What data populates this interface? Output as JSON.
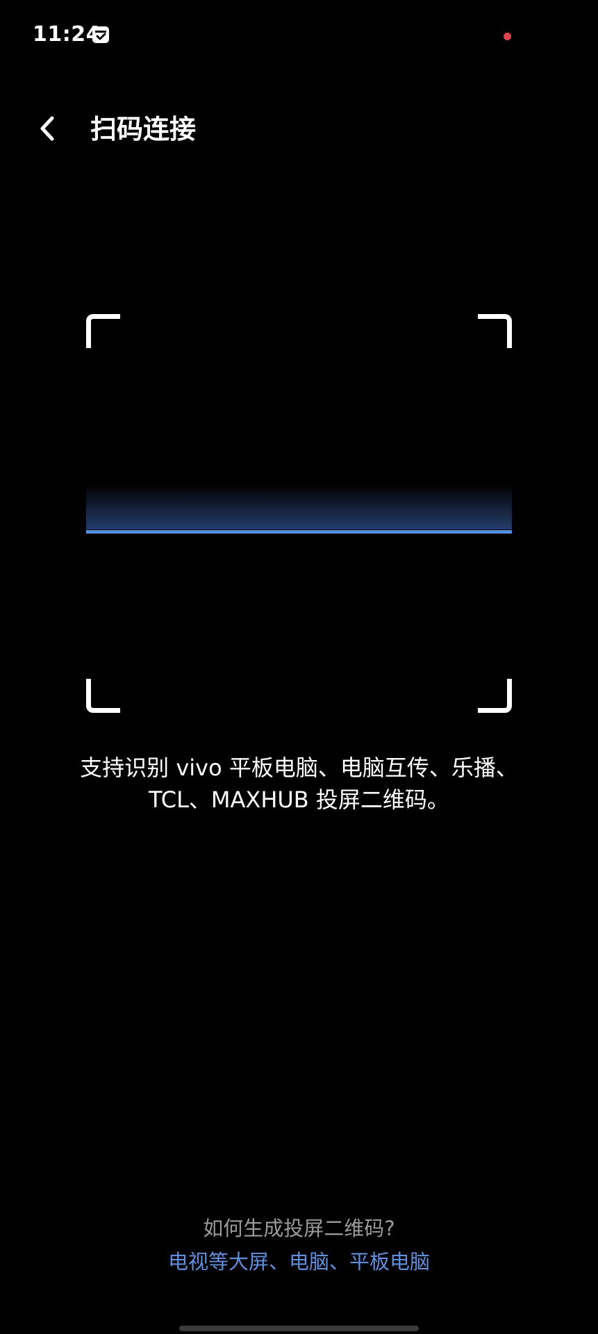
{
  "status_bar": {
    "time": "11:24",
    "app_icon": "calendar-check-icon",
    "notification_dot_color": "#e0434b"
  },
  "header": {
    "back_icon": "chevron-left-icon",
    "title": "扫码连接"
  },
  "scanner": {
    "accent_color": "#4e8fe8",
    "corner_color": "#ffffff"
  },
  "description": {
    "line1": "支持识别 vivo 平板电脑、电脑互传、乐播、",
    "line2": "TCL、MAXHUB 投屏二维码。"
  },
  "help": {
    "question": "如何生成投屏二维码?",
    "link": "电视等大屏、电脑、平板电脑",
    "link_color": "#5b8fe0"
  }
}
